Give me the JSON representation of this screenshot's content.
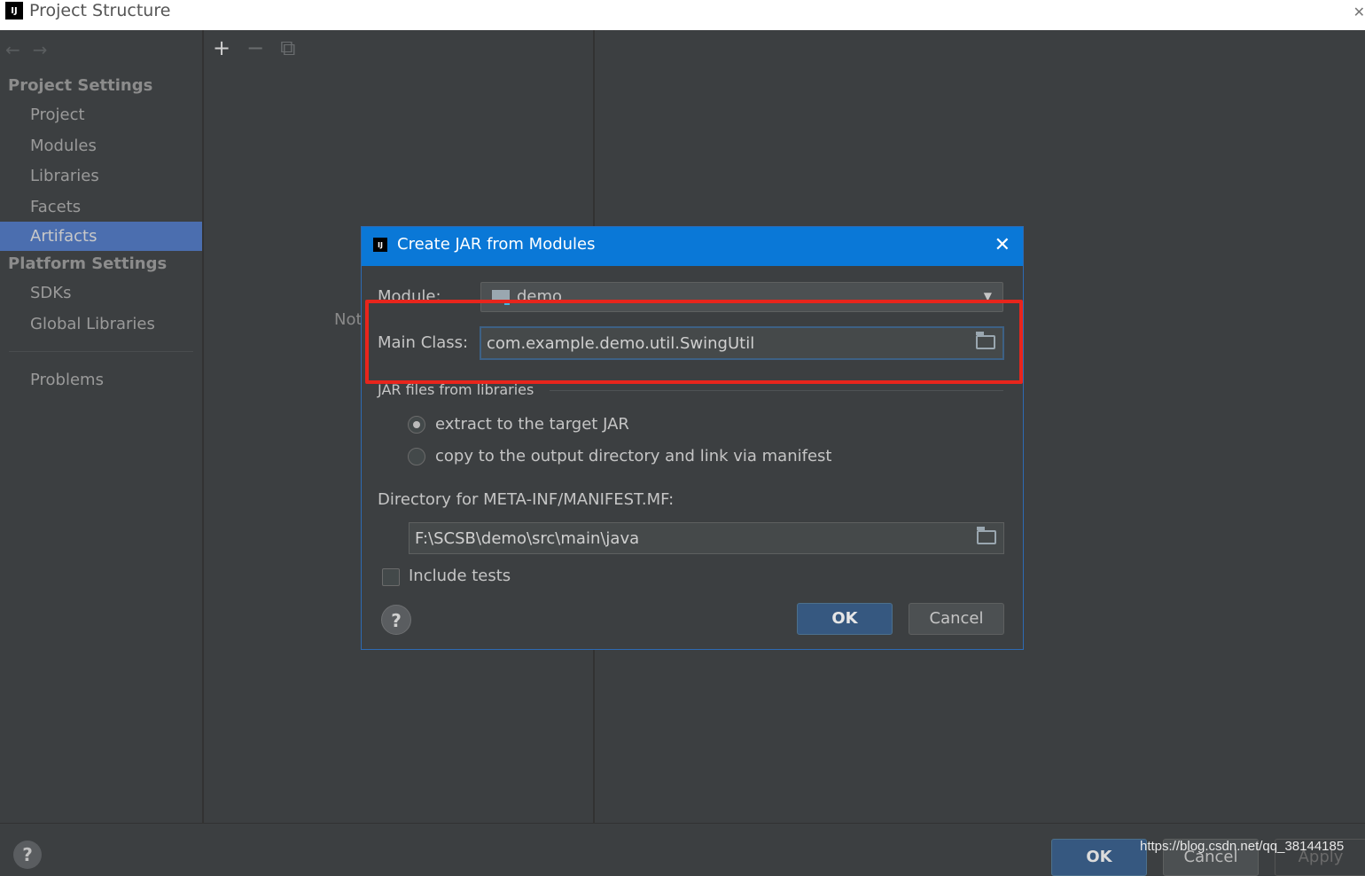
{
  "window": {
    "title": "Project Structure",
    "logo": "IJ"
  },
  "sidebar": {
    "section_project": "Project Settings",
    "items_project": [
      "Project",
      "Modules",
      "Libraries",
      "Facets",
      "Artifacts"
    ],
    "selected": "Artifacts",
    "section_platform": "Platform Settings",
    "items_platform": [
      "SDKs",
      "Global Libraries"
    ],
    "problems": "Problems"
  },
  "middle": {
    "partial_text": "Not"
  },
  "bottom": {
    "ok": "OK",
    "cancel": "Cancel",
    "apply": "Apply",
    "help": "?",
    "watermark": "https://blog.csdn.net/qq_38144185"
  },
  "dialog": {
    "title": "Create JAR from Modules",
    "module_label": "Module:",
    "module_value": "demo",
    "main_class_label": "Main Class:",
    "main_class_value": "com.example.demo.util.SwingUtil",
    "jar_group_title": "JAR files from libraries",
    "radio_extract": "extract to the target JAR",
    "radio_copy": "copy to the output directory and link via manifest",
    "selected_radio": "extract",
    "manifest_label": "Directory for META-INF/MANIFEST.MF:",
    "manifest_value": "F:\\SCSB\\demo\\src\\main\\java",
    "include_tests": "Include tests",
    "include_tests_checked": false,
    "ok": "OK",
    "cancel": "Cancel",
    "help": "?"
  },
  "colors": {
    "selection": "#4b6eaf",
    "dialog_title_bar": "#0a78d7",
    "highlight_box": "#e8251c",
    "primary_button": "#365880"
  }
}
